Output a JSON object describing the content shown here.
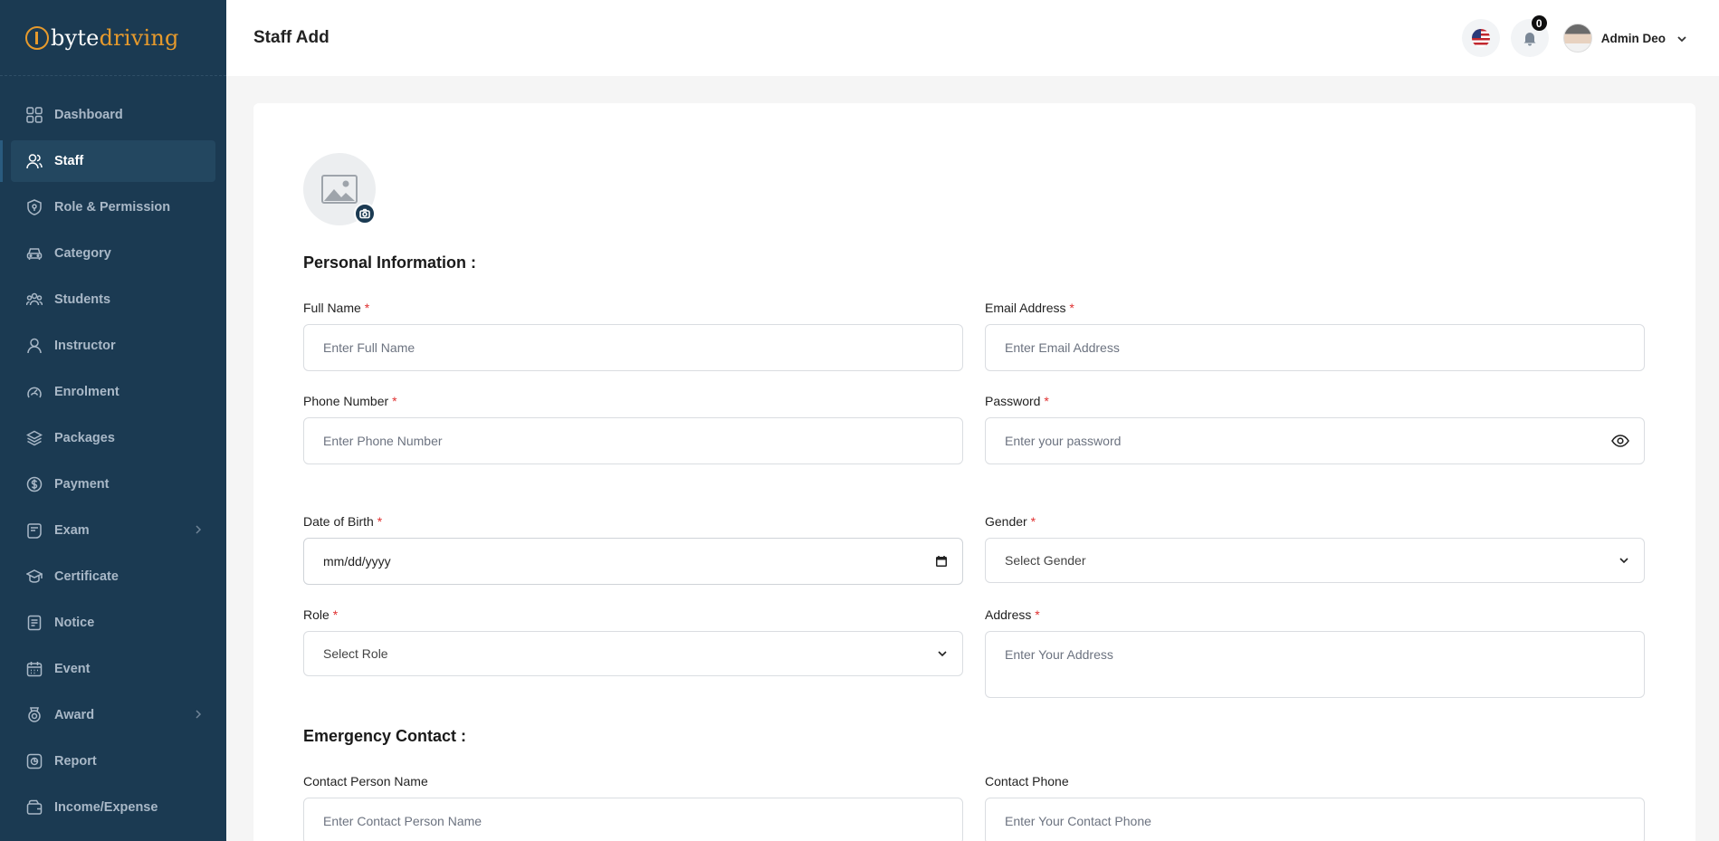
{
  "brand": {
    "logo_part1": "byte",
    "logo_part2": "driving"
  },
  "sidebar": {
    "items": [
      {
        "label": "Dashboard",
        "icon": "dashboard-icon"
      },
      {
        "label": "Staff",
        "icon": "staff-icon",
        "active": true
      },
      {
        "label": "Role & Permission",
        "icon": "shield-icon"
      },
      {
        "label": "Category",
        "icon": "car-icon"
      },
      {
        "label": "Students",
        "icon": "students-icon"
      },
      {
        "label": "Instructor",
        "icon": "user-icon"
      },
      {
        "label": "Enrolment",
        "icon": "enrolment-icon"
      },
      {
        "label": "Packages",
        "icon": "layers-icon"
      },
      {
        "label": "Payment",
        "icon": "dollar-icon"
      },
      {
        "label": "Exam",
        "icon": "exam-icon",
        "has_submenu": true
      },
      {
        "label": "Certificate",
        "icon": "graduation-cap-icon"
      },
      {
        "label": "Notice",
        "icon": "notice-icon"
      },
      {
        "label": "Event",
        "icon": "calendar-icon"
      },
      {
        "label": "Award",
        "icon": "award-icon",
        "has_submenu": true
      },
      {
        "label": "Report",
        "icon": "report-icon"
      },
      {
        "label": "Income/Expense",
        "icon": "wallet-icon"
      }
    ]
  },
  "header": {
    "title": "Staff Add",
    "notification_count": "0",
    "user_name": "Admin Deo"
  },
  "form": {
    "personal_heading": "Personal Information :",
    "full_name": {
      "label": "Full Name",
      "placeholder": "Enter Full Name"
    },
    "email": {
      "label": "Email Address",
      "placeholder": "Enter Email Address"
    },
    "phone": {
      "label": "Phone Number",
      "placeholder": "Enter Phone Number"
    },
    "password": {
      "label": "Password",
      "placeholder": "Enter your password"
    },
    "dob": {
      "label": "Date of Birth",
      "value": "mm/dd/yyyy"
    },
    "gender": {
      "label": "Gender",
      "value": "Select Gender"
    },
    "role": {
      "label": "Role",
      "value": "Select Role"
    },
    "address": {
      "label": "Address",
      "placeholder": "Enter Your Address"
    },
    "emergency_heading": "Emergency Contact :",
    "contact_name": {
      "label": "Contact Person Name",
      "placeholder": "Enter Contact Person Name"
    },
    "contact_phone": {
      "label": "Contact Phone",
      "placeholder": "Enter Your Contact Phone"
    },
    "required_mark": "*"
  },
  "colors": {
    "sidebar_bg": "#1b3a52",
    "accent_orange": "#e79a2c",
    "required_red": "#e03131"
  }
}
